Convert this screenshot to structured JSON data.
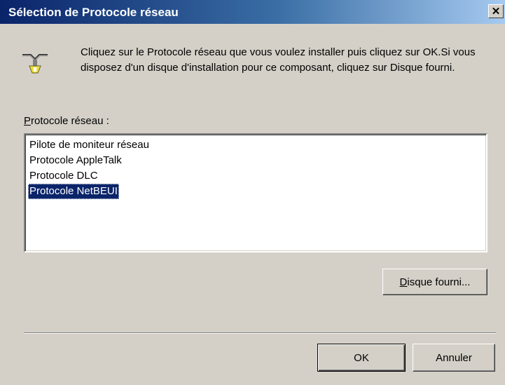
{
  "window": {
    "title": "Sélection de Protocole réseau",
    "close_glyph": "✕"
  },
  "icon": "network-protocol-icon",
  "instructions": "Cliquez sur le Protocole réseau que vous voulez installer puis cliquez sur OK.Si vous disposez d'un disque d'installation pour ce composant, cliquez sur Disque fourni.",
  "list": {
    "label_accel": "P",
    "label_rest": "rotocole réseau :",
    "items": [
      "Pilote de moniteur réseau",
      "Protocole AppleTalk",
      "Protocole DLC",
      "Protocole NetBEUI"
    ],
    "selected": "Protocole NetBEUI"
  },
  "buttons": {
    "have_disk_accel": "D",
    "have_disk_rest": "isque fourni...",
    "ok": "OK",
    "cancel": "Annuler"
  },
  "colors": {
    "title_start": "#0a246a",
    "title_end": "#a6caf0",
    "selection": "#0a246a",
    "face": "#d4d0c8"
  }
}
